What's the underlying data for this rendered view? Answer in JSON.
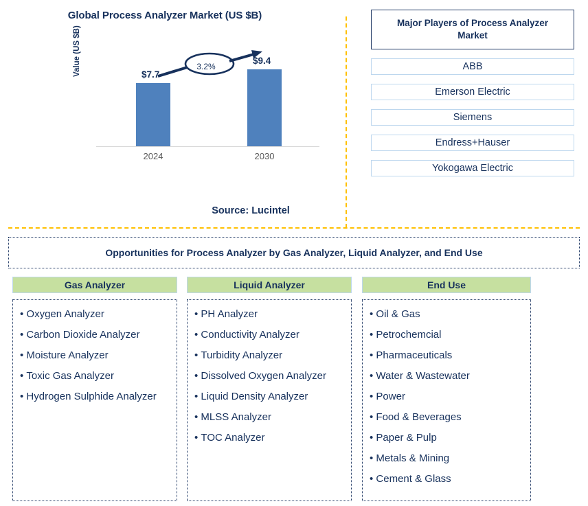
{
  "chart_panel": {
    "title": "Global Process Analyzer Market (US $B)",
    "y_axis_label": "Value (US $B)",
    "source": "Source: Lucintel",
    "cagr_label": "3.2%"
  },
  "chart_data": {
    "type": "bar",
    "title": "Global Process Analyzer Market (US $B)",
    "categories": [
      "2024",
      "2030"
    ],
    "values": [
      7.7,
      9.4
    ],
    "value_labels": [
      "$7.7",
      "$9.4"
    ],
    "xlabel": "",
    "ylabel": "Value (US $B)",
    "ylim": [
      0,
      11
    ],
    "grid": false,
    "legend": "none",
    "bar_color": "#4F81BD",
    "annotations": [
      {
        "text": "3.2%",
        "kind": "cagr-callout",
        "from": "2024",
        "to": "2030"
      }
    ],
    "source": "Source: Lucintel"
  },
  "players": {
    "header": "Major Players of Process Analyzer Market",
    "items": [
      "ABB",
      "Emerson Electric",
      "Siemens",
      "Endress+Hauser",
      "Yokogawa Electric"
    ]
  },
  "opportunities": {
    "banner": "Opportunities for Process Analyzer by Gas Analyzer, Liquid Analyzer, and End Use",
    "columns": [
      {
        "header": "Gas Analyzer",
        "items": [
          "Oxygen Analyzer",
          "Carbon Dioxide Analyzer",
          "Moisture Analyzer",
          "Toxic Gas Analyzer",
          "Hydrogen Sulphide Analyzer"
        ]
      },
      {
        "header": "Liquid Analyzer",
        "items": [
          "PH Analyzer",
          "Conductivity Analyzer",
          "Turbidity Analyzer",
          "Dissolved Oxygen Analyzer",
          "Liquid Density Analyzer",
          "MLSS Analyzer",
          "TOC Analyzer"
        ]
      },
      {
        "header": "End Use",
        "items": [
          "Oil & Gas",
          "Petrochemcial",
          "Pharmaceuticals",
          "Water & Wastewater",
          "Power",
          "Food & Beverages",
          "Paper & Pulp",
          "Metals & Mining",
          "Cement & Glass"
        ]
      }
    ]
  },
  "colors": {
    "navy": "#1F3864",
    "bar_blue": "#4F81BD",
    "divider_orange": "#FFC000",
    "header_green": "#C6E0A0",
    "box_border_blue": "#BDD7EE"
  }
}
